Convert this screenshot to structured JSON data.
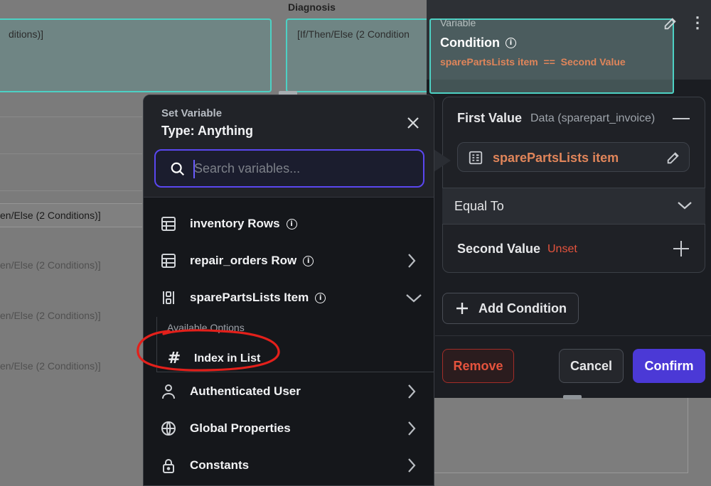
{
  "background": {
    "column_header": "Diagnosis",
    "cards": [
      "ditions)]",
      "[If/Then/Else (2 Condition"
    ],
    "rows": [
      "en/Else (2 Conditions)]",
      "en/Else (2 Conditions)]",
      "en/Else (2 Conditions)]",
      "en/Else (2 Conditions)]"
    ]
  },
  "condition_header": {
    "variable_label": "Variable",
    "title": "Condition",
    "expression": "sparePartsLists item  ==  Second Value"
  },
  "first_value": {
    "label": "First Value",
    "source": "Data (sparepart_invoice)",
    "value": "sparePartsLists item"
  },
  "operator": {
    "selected": "Equal To"
  },
  "second_value": {
    "label": "Second Value",
    "status": "Unset"
  },
  "add_condition_label": "Add Condition",
  "buttons": {
    "remove": "Remove",
    "cancel": "Cancel",
    "confirm": "Confirm"
  },
  "set_variable": {
    "subtitle": "Set Variable",
    "type_label": "Type: Anything",
    "search_placeholder": "Search variables...",
    "items": [
      {
        "label": "inventory Rows",
        "icon": "table-icon"
      },
      {
        "label": "repair_orders Row",
        "icon": "table-icon"
      },
      {
        "label": "sparePartsLists Item",
        "icon": "list-item-icon"
      },
      {
        "label": "Authenticated User",
        "icon": "user-icon"
      },
      {
        "label": "Global Properties",
        "icon": "globe-icon"
      },
      {
        "label": "Constants",
        "icon": "lock-icon"
      }
    ],
    "available_options_label": "Available Options",
    "option_index": "Index in List"
  },
  "colors": {
    "accent_purple": "#4b39d6",
    "search_border": "#5a47f0",
    "expression_orange": "#e0855a",
    "teal_outline": "#4dd1c4",
    "danger_red": "#e5533d"
  }
}
